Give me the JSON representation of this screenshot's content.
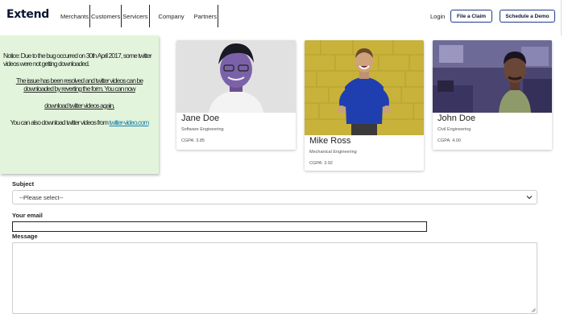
{
  "header": {
    "logo": "Extend",
    "nav": [
      "Merchants",
      "Customers",
      "Servicers",
      "Company",
      "Partners"
    ],
    "login": "Login",
    "claim_button": "File a Claim",
    "demo_button": "Schedule a Demo"
  },
  "notice": {
    "line1": "Notice: Due to the bug occurred on 30th April 2017, some twitter videos were not getting downloaded.",
    "line2": "The issue has been resolved and twitter videos can be downloaded by reverting the form. You can now",
    "line3": "download twitter videos again.",
    "line4_prefix": "You can also download twitter videos from ",
    "link": "twitter-video.com",
    "bg_color": "#e2f5dc"
  },
  "cards": [
    {
      "name": "Jane Doe",
      "department": "Software Engineering",
      "cgpa": "CGPA: 3.85",
      "photo_bg": "#d8d8d8",
      "shirt": "#f2f2f2",
      "skin": "#7a5a9a"
    },
    {
      "name": "Mike Ross",
      "department": "Mechanical Engineering",
      "cgpa": "CGPA: 3.92",
      "photo_bg": "#c9b23a",
      "shirt": "#1e3fae",
      "skin": "#c6a07a"
    },
    {
      "name": "John Doe",
      "department": "Civil Engineering",
      "cgpa": "CGPA: 4.00",
      "photo_bg": "#4d4775",
      "shirt": "#8a9a6a",
      "skin": "#6a4a3a"
    }
  ],
  "form": {
    "subject_label": "Subject",
    "subject_value": "--Please select--",
    "email_label": "Your email",
    "email_value": "",
    "message_label": "Message",
    "message_value": ""
  },
  "colors": {
    "accent": "#1e3a8a",
    "brand_text": "#0b1533"
  }
}
